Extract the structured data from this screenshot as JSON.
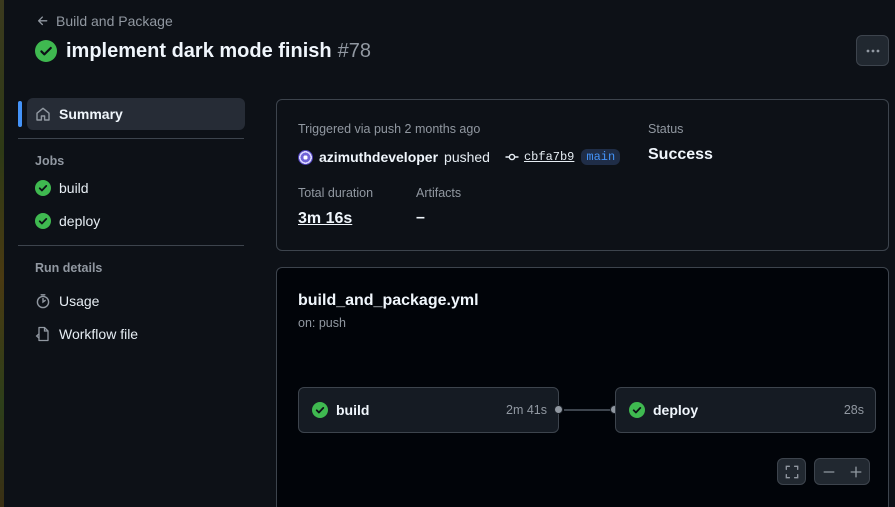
{
  "header": {
    "back_label": "Build and Package",
    "run_title": "implement dark mode finish",
    "run_number": "#78"
  },
  "sidebar": {
    "summary_label": "Summary",
    "jobs_heading": "Jobs",
    "jobs": [
      {
        "label": "build",
        "status": "success"
      },
      {
        "label": "deploy",
        "status": "success"
      }
    ],
    "run_details_heading": "Run details",
    "details": [
      {
        "label": "Usage",
        "icon": "stopwatch-icon"
      },
      {
        "label": "Workflow file",
        "icon": "file-code-icon"
      }
    ]
  },
  "summary": {
    "trigger_label": "Triggered via push 2 months ago",
    "actor": "azimuthdeveloper",
    "action": "pushed",
    "commit_sha": "cbfa7b9",
    "branch": "main",
    "status_label": "Status",
    "status_value": "Success",
    "duration_label": "Total duration",
    "duration_value": "3m 16s",
    "artifacts_label": "Artifacts",
    "artifacts_value": "–"
  },
  "graph": {
    "workflow_file": "build_and_package.yml",
    "trigger": "on: push",
    "jobs": [
      {
        "name": "build",
        "duration": "2m 41s",
        "status": "success"
      },
      {
        "name": "deploy",
        "duration": "28s",
        "status": "success"
      }
    ]
  },
  "colors": {
    "success": "#3fb950",
    "accent": "#4493f8",
    "background": "#0d1117"
  }
}
